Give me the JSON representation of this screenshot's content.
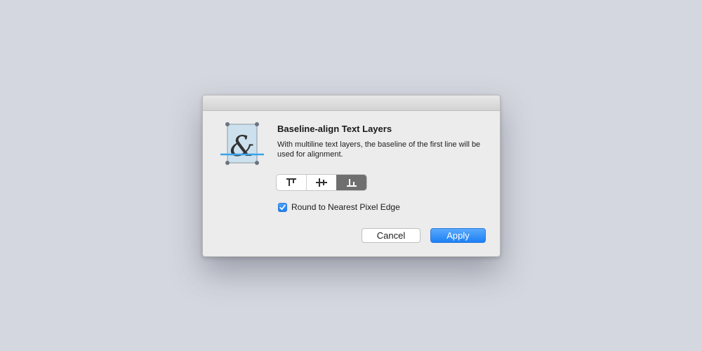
{
  "dialog": {
    "title": "Baseline-align Text Layers",
    "description": "With multiline text layers, the baseline of the first line will be used for alignment.",
    "icon_glyph": "&",
    "icon_name": "baseline-ampersand-icon",
    "alignment_options": [
      {
        "name": "align-top-icon",
        "selected": false
      },
      {
        "name": "align-middle-icon",
        "selected": false
      },
      {
        "name": "align-baseline-icon",
        "selected": true
      }
    ],
    "checkbox": {
      "label": "Round to Nearest Pixel Edge",
      "checked": true
    },
    "buttons": {
      "cancel": "Cancel",
      "apply": "Apply"
    }
  },
  "colors": {
    "accent": "#1d80f5",
    "baseline": "#3aa3ea",
    "selected_segment": "#6f6f6f"
  }
}
